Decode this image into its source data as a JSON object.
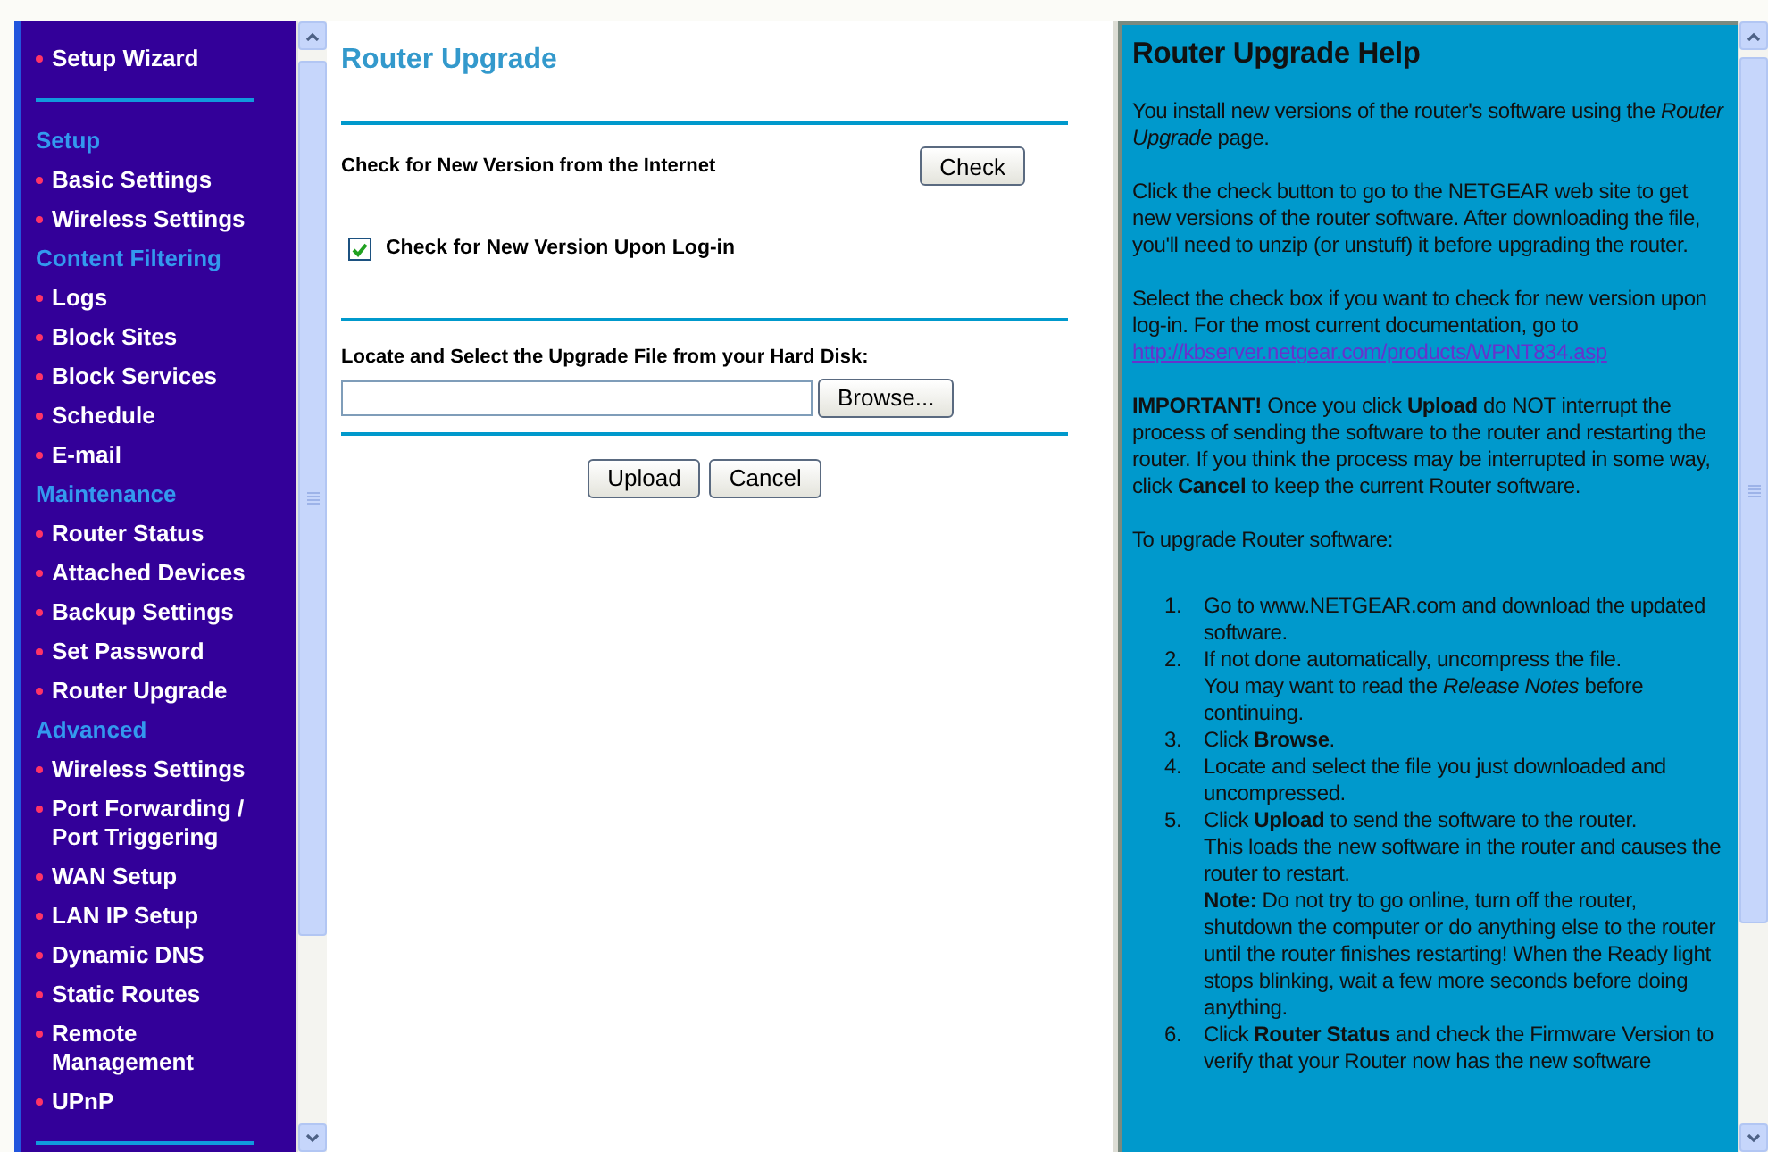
{
  "sidebar": {
    "items": [
      {
        "kind": "link",
        "label": "Setup Wizard"
      },
      {
        "kind": "divider"
      },
      {
        "kind": "heading",
        "label": "Setup"
      },
      {
        "kind": "link",
        "label": "Basic Settings"
      },
      {
        "kind": "link",
        "label": "Wireless Settings"
      },
      {
        "kind": "heading",
        "label": "Content Filtering"
      },
      {
        "kind": "link",
        "label": "Logs"
      },
      {
        "kind": "link",
        "label": "Block Sites"
      },
      {
        "kind": "link",
        "label": "Block Services"
      },
      {
        "kind": "link",
        "label": "Schedule"
      },
      {
        "kind": "link",
        "label": "E-mail"
      },
      {
        "kind": "heading",
        "label": "Maintenance"
      },
      {
        "kind": "link",
        "label": "Router Status"
      },
      {
        "kind": "link",
        "label": "Attached Devices"
      },
      {
        "kind": "link",
        "label": "Backup Settings"
      },
      {
        "kind": "link",
        "label": "Set Password"
      },
      {
        "kind": "link",
        "label": "Router Upgrade"
      },
      {
        "kind": "heading",
        "label": "Advanced"
      },
      {
        "kind": "link",
        "label": "Wireless Settings"
      },
      {
        "kind": "link",
        "label": "Port Forwarding / Port Triggering"
      },
      {
        "kind": "link",
        "label": "WAN Setup"
      },
      {
        "kind": "link",
        "label": "LAN IP Setup"
      },
      {
        "kind": "link",
        "label": "Dynamic DNS"
      },
      {
        "kind": "link",
        "label": "Static Routes"
      },
      {
        "kind": "link",
        "label": "Remote Management"
      },
      {
        "kind": "link",
        "label": "UPnP"
      },
      {
        "kind": "divider"
      }
    ]
  },
  "main": {
    "title": "Router Upgrade",
    "check_row": {
      "label": "Check for New Version from the Internet",
      "button": "Check"
    },
    "login_check": {
      "label": "Check for New Version Upon Log-in",
      "checked": true
    },
    "file_row": {
      "label": "Locate and Select the Upgrade File from your Hard Disk:",
      "browse": "Browse..."
    },
    "buttons": [
      "Upload",
      "Cancel"
    ]
  },
  "help": {
    "title": "Router Upgrade Help",
    "paragraphs": [
      {
        "text": "You install new versions of the router's software using the *Router Upgrade* page."
      },
      {
        "text": "Click the check button to go to the NETGEAR web site to get new versions of the router software. After downloading the file, you'll need to unzip (or unstuff) it before upgrading the router."
      },
      {
        "text": "Select the check box if you want to check for new version upon log-in. For the most current documentation, go to",
        "link": "http://kbserver.netgear.com/products/WPNT834.asp"
      },
      {
        "text": "**IMPORTANT!** Once you click **Upload** do NOT interrupt the process of sending the software to the router and restarting the router. If you think the process may be interrupted in some way, click **Cancel** to keep the current Router software."
      },
      {
        "text": "To upgrade Router software:"
      }
    ],
    "steps": [
      {
        "number": "1.",
        "lines": [
          "Go to www.NETGEAR.com and download the updated software."
        ]
      },
      {
        "number": "2.",
        "lines": [
          "If not done automatically, uncompress the file.",
          "You may want to read the *Release Notes* before continuing."
        ]
      },
      {
        "number": "3.",
        "lines": [
          "Click **Browse**."
        ]
      },
      {
        "number": "4.",
        "lines": [
          "Locate and select the file you just downloaded and uncompressed."
        ]
      },
      {
        "number": "5.",
        "lines": [
          "Click **Upload** to send the software to the router.",
          "This loads the new software in the router and causes the router to restart.",
          "**Note:** Do not try to go online, turn off the router, shutdown the computer or do anything else to the router until the router finishes restarting! When the Ready light stops blinking, wait a few more seconds before doing anything."
        ]
      },
      {
        "number": "6.",
        "lines": [
          "Click **Router Status** and check the Firmware Version to verify that your Router now has the new software"
        ]
      }
    ]
  }
}
